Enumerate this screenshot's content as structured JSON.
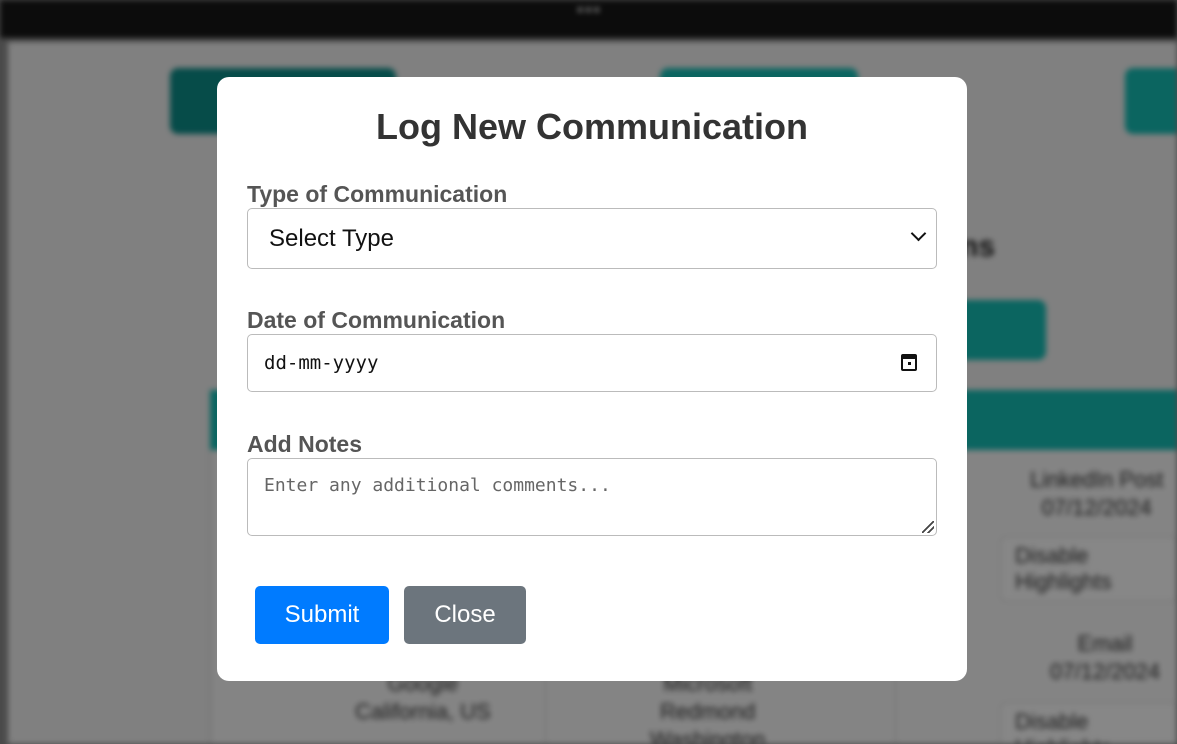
{
  "background": {
    "title": "...",
    "table_cells": [
      {
        "lines": [
          "LinkedIn Post",
          "07/12/2024"
        ]
      },
      {
        "lines": [
          "Email",
          "07/12/2024"
        ]
      },
      {
        "lines": [
          "Google",
          "California, US"
        ]
      },
      {
        "lines": [
          "Microsoft",
          "Redmond",
          "Washington"
        ]
      }
    ],
    "pill_label": "Disable Highlights"
  },
  "modal": {
    "title": "Log New Communication",
    "type_label": "Type of Communication",
    "type_selected": "Select Type",
    "date_label": "Date of Communication",
    "date_placeholder": "dd-mm-yyyy",
    "notes_label": "Add Notes",
    "notes_placeholder": "Enter any additional comments...",
    "submit_label": "Submit",
    "close_label": "Close"
  },
  "colors": {
    "primary": "#007bff",
    "secondary": "#6c757d",
    "accent_teal": "#14b8b0"
  },
  "icons": [
    "chevron-down-icon",
    "calendar-icon",
    "resize-handle-icon"
  ]
}
